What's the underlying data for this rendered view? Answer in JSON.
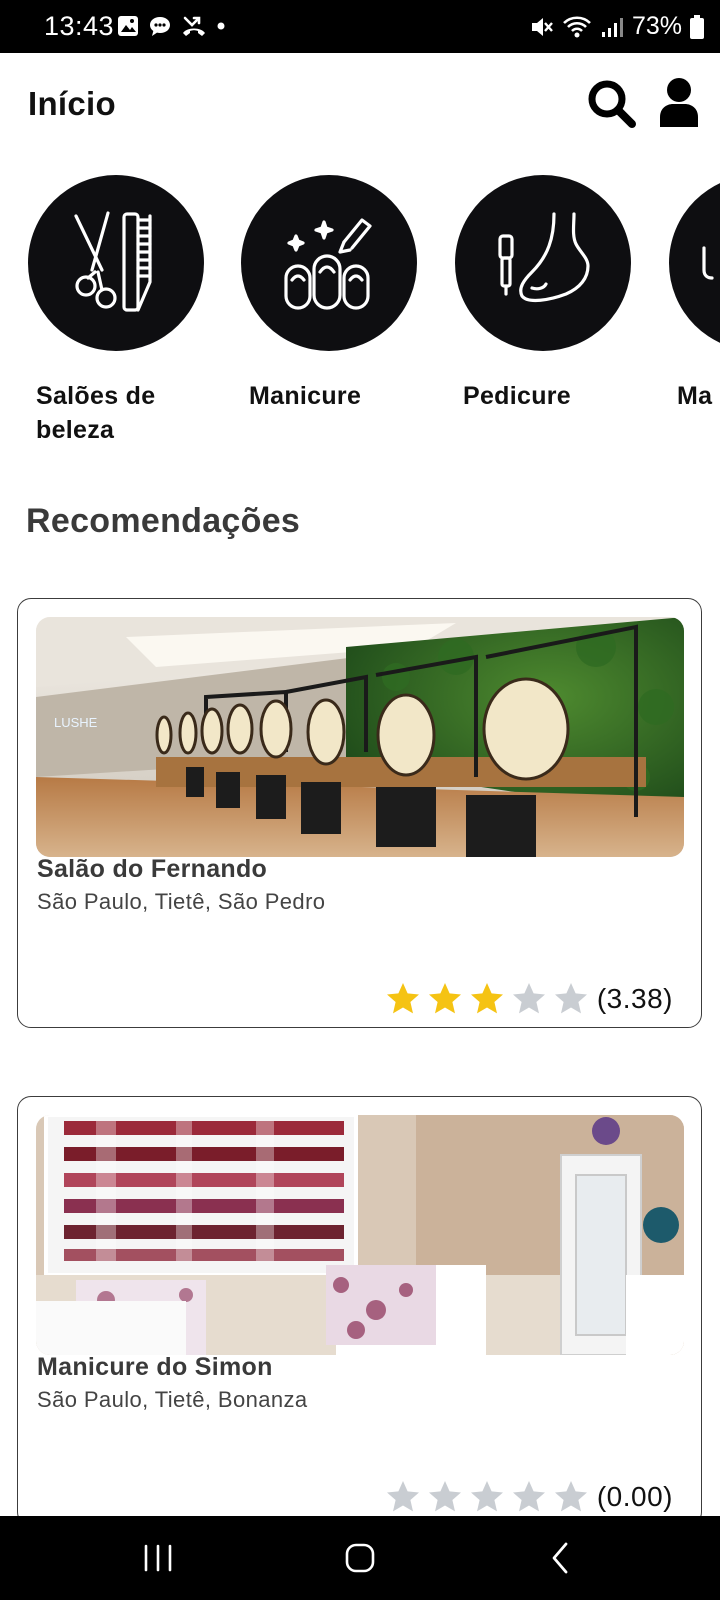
{
  "status_bar": {
    "time": "13:43",
    "battery": "73%",
    "icons": [
      "image-icon",
      "chat-icon",
      "missed-call-icon",
      "dot-icon",
      "mute-icon",
      "wifi-icon",
      "signal-icon",
      "battery-icon"
    ]
  },
  "header": {
    "title": "Início",
    "icons": [
      "search-icon",
      "user-icon"
    ]
  },
  "categories": [
    {
      "label": "Salões de beleza",
      "icon": "scissors-comb-icon"
    },
    {
      "label": "Manicure",
      "icon": "nail-polish-icon"
    },
    {
      "label": "Pedicure",
      "icon": "foot-icon"
    },
    {
      "label": "Ma",
      "icon": "partial-category-icon"
    }
  ],
  "recommendations": {
    "title": "Recomendações",
    "items": [
      {
        "name": "Salão do Fernando",
        "location": "São Paulo, Tietê, São Pedro",
        "rating": 3.38,
        "rating_text": "(3.38)",
        "filled_stars": 3,
        "image_sign": "LUSHE"
      },
      {
        "name": "Manicure do Simon",
        "location": "São Paulo, Tietê, Bonanza",
        "rating": 0.0,
        "rating_text": "(0.00)",
        "filled_stars": 0
      }
    ]
  },
  "colors": {
    "star_filled": "#f5c313",
    "star_empty": "#c9cdd2",
    "circle_bg": "#0e0e11"
  },
  "nav_bar": {
    "buttons": [
      "recent-apps-icon",
      "home-icon",
      "back-icon"
    ]
  }
}
